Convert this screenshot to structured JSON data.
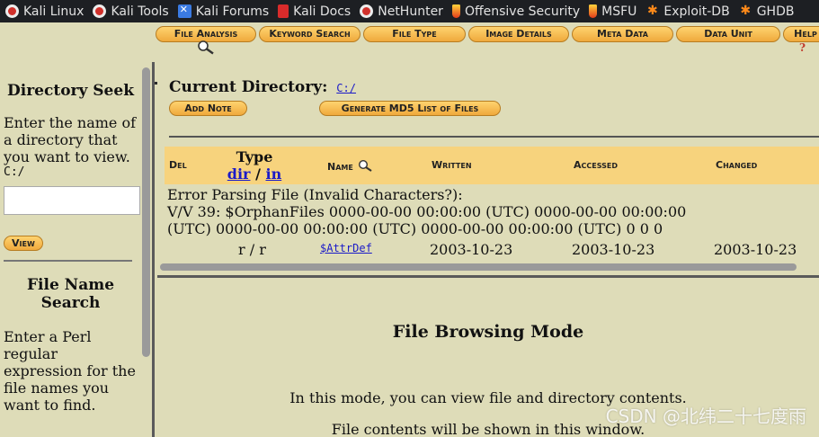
{
  "bookmarks": [
    {
      "label": "Kali Linux",
      "icon": "kali-dragon-icon"
    },
    {
      "label": "Kali Tools",
      "icon": "kali-dragon-icon"
    },
    {
      "label": "Kali Forums",
      "icon": "forum-icon"
    },
    {
      "label": "Kali Docs",
      "icon": "docs-icon"
    },
    {
      "label": "NetHunter",
      "icon": "kali-dragon-icon"
    },
    {
      "label": "Offensive Security",
      "icon": "offsec-flame-icon"
    },
    {
      "label": "MSFU",
      "icon": "offsec-flame-icon"
    },
    {
      "label": "Exploit-DB",
      "icon": "exploitdb-spider-icon"
    },
    {
      "label": "GHDB",
      "icon": "exploitdb-spider-icon"
    }
  ],
  "tabs": [
    {
      "label": "File Analysis"
    },
    {
      "label": "Keyword Search"
    },
    {
      "label": "File Type"
    },
    {
      "label": "Image Details"
    },
    {
      "label": "Meta Data"
    },
    {
      "label": "Data Unit"
    },
    {
      "label": "Help"
    }
  ],
  "tab_help_icon": "?",
  "sidebar": {
    "dir_seek_title": "Directory Seek",
    "dir_seek_text": "Enter the name of a directory that you want to view.",
    "dir_seek_prefix": "C:/",
    "dir_input_value": "",
    "view_button": "View",
    "file_search_title": "File Name Search",
    "file_search_text": "Enter a Perl regular expression for the file names you want to find."
  },
  "main": {
    "current_dir_label": "Current Directory:",
    "current_dir_link": "C:/",
    "add_note": "Add Note",
    "generate_md5": "Generate MD5 List of Files",
    "columns": {
      "del": "Del",
      "type": "Type",
      "type_dir": "dir",
      "type_sep": "/",
      "type_in": "in",
      "name": "Name",
      "written": "Written",
      "accessed": "Accessed",
      "changed": "Changed"
    },
    "error_line_1": "Error Parsing File (Invalid Characters?):",
    "error_line_2": "V/V 39: $OrphanFiles 0000-00-00 00:00:00 (UTC) 0000-00-00 00:00:00",
    "error_line_3": "(UTC) 0000-00-00 00:00:00 (UTC) 0000-00-00 00:00:00 (UTC) 0 0 0",
    "row": {
      "type": "r / r",
      "name": "$AttrDef",
      "written": "2003-10-23",
      "accessed": "2003-10-23",
      "changed": "2003-10-23"
    }
  },
  "browse": {
    "title": "File Browsing Mode",
    "line1": "In this mode, you can view file and directory contents.",
    "line2": "File contents will be shown in this window."
  },
  "watermark": "CSDN @北纬二十七度雨"
}
